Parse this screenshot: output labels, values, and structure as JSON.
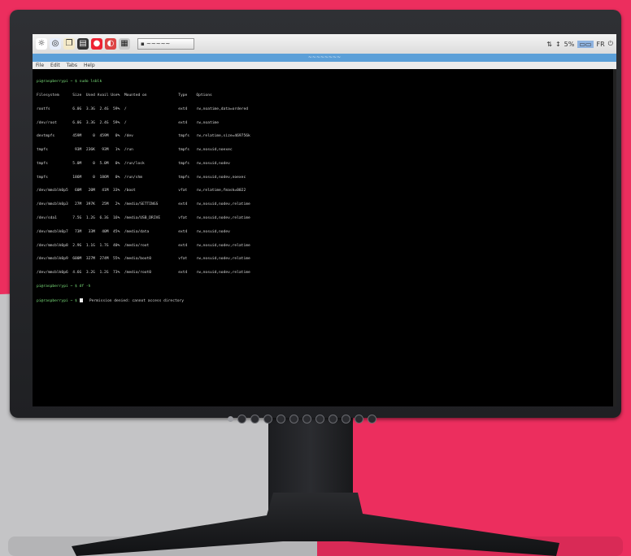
{
  "panel": {
    "launchers": [
      "☼",
      "◎",
      "❐",
      "▤",
      "●",
      "◐",
      "▦"
    ],
    "task_label": "▪ ~~~~~",
    "tray_items": [
      "⇅",
      "↕",
      "5%",
      "▭▭",
      "FR",
      "⏻"
    ]
  },
  "window": {
    "title": "~~~~~~~~",
    "menu": [
      "File",
      "Edit",
      "Tabs",
      "Help"
    ]
  },
  "terminal": {
    "lines": [
      "pi@raspberrypi ~ $ sudo lsblk",
      "Filesystem      Size  Used Avail Use%  Mounted on              Type    Options",
      "rootfs          6.0G  3.3G  2.4G  59%  /                       ext4    rw,noatime,data=ordered",
      "/dev/root       6.0G  3.3G  2.4G  59%  /                       ext4    rw,noatime",
      "devtmpfs        459M     0  459M   0%  /dev                    tmpfs   rw,relatime,size=469756k",
      "tmpfs            93M  236K   93M   1%  /run                    tmpfs   rw,nosuid,noexec",
      "tmpfs           5.0M     0  5.0M   0%  /run/lock               tmpfs   rw,nosuid,nodev",
      "tmpfs           186M     0  186M   0%  /run/shm                tmpfs   rw,nosuid,nodev,noexec",
      "/dev/mmcblk0p5   60M   20M   41M  33%  /boot                   vfat    rw,relatime,fmask=0022",
      "/dev/mmcblk0p3   27M  397K   25M   2%  /media/SETTINGS         ext4    rw,nosuid,nodev,relatime",
      "/dev/sda1       7.5G  1.2G  6.3G  16%  /media/USB_DRIVE        vfat    rw,nosuid,nodev,relatime",
      "/dev/mmcblk0p7   73M   33M   40M  45%  /media/data             ext4    rw,nosuid,nodev",
      "/dev/mmcblk0p8  2.9G  1.1G  1.7G  40%  /media/root             ext4    rw,nosuid,nodev,relatime",
      "/dev/mmcblk0p9  600M  327M  274M  55%  /media/boot0            vfat    rw,nosuid,nodev,relatime",
      "/dev/mmcblk0p6  4.6G  3.2G  1.2G  73%  /media/root0            ext4    rw,nosuid,nodev,relatime",
      "pi@raspberrypi ~ $ df -h",
      "pi@raspberrypi ~ $ "
    ],
    "prompt_suffix": "   Permission denied: cannot access directory"
  },
  "monitor": {
    "button_count": 11
  }
}
